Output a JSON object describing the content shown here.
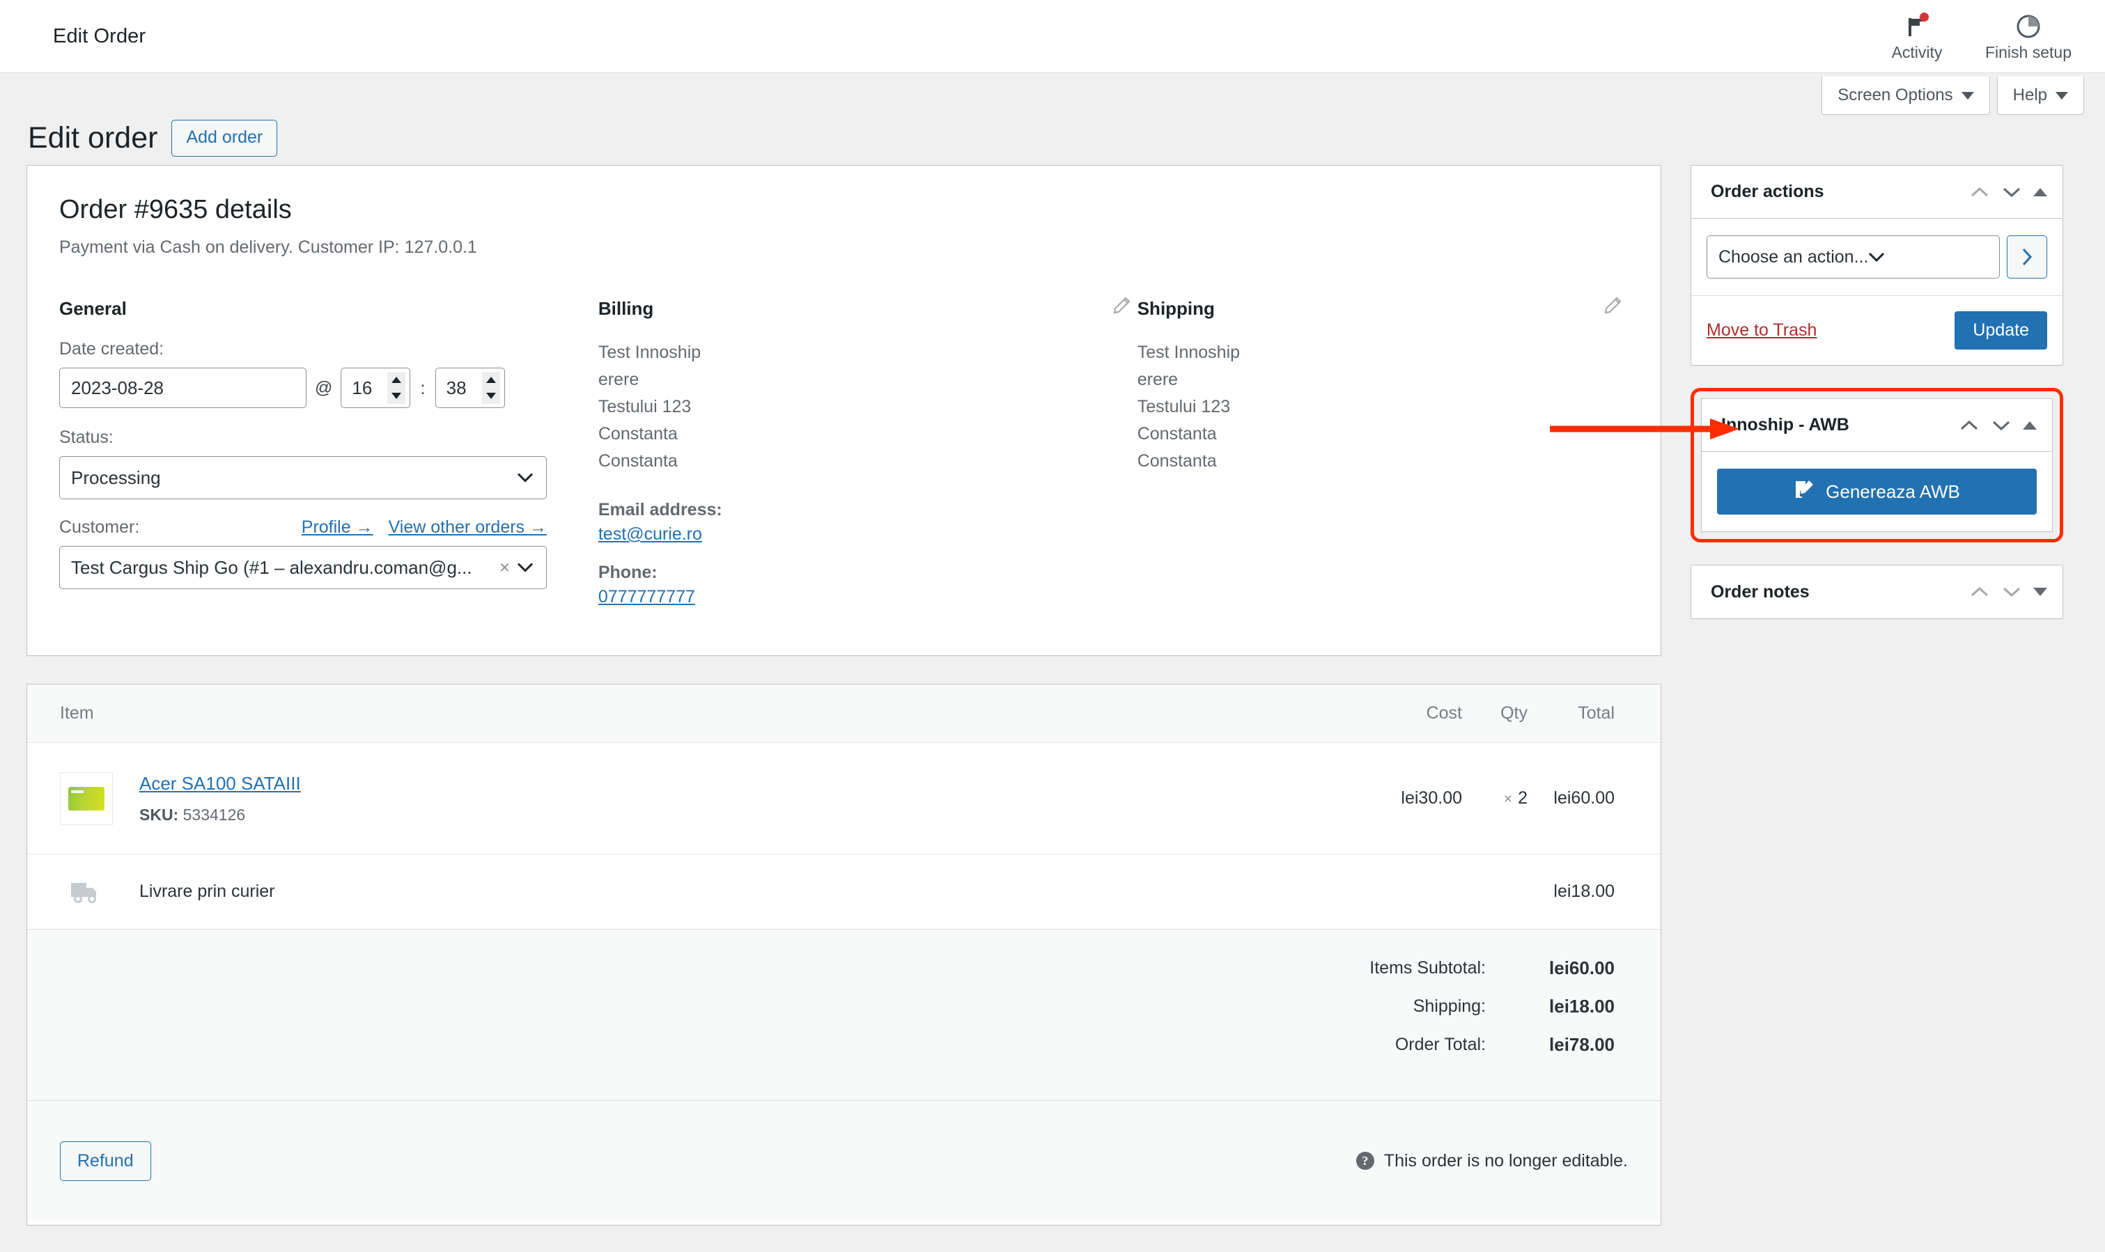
{
  "adminbar": {
    "title": "Edit Order",
    "items": [
      {
        "label": "Activity",
        "icon": "flag-icon"
      },
      {
        "label": "Finish setup",
        "icon": "progress-circle-icon"
      }
    ]
  },
  "screen_meta": {
    "screen_options": "Screen Options",
    "help": "Help"
  },
  "page": {
    "title": "Edit order",
    "add_order_button": "Add order"
  },
  "order": {
    "heading": "Order #9635 details",
    "subheading": "Payment via Cash on delivery. Customer IP: 127.0.0.1",
    "general": {
      "title": "General",
      "date_label": "Date created:",
      "date_value": "2023-08-28",
      "at_symbol": "@",
      "hour_value": "16",
      "colon": ":",
      "minute_value": "38",
      "status_label": "Status:",
      "status_value": "Processing",
      "customer_label": "Customer:",
      "profile_link": "Profile →",
      "view_other_orders_link": "View other orders →",
      "customer_value": "Test Cargus Ship Go (#1 – alexandru.coman@g...",
      "clear_symbol": "×"
    },
    "billing": {
      "title": "Billing",
      "address": [
        "Test Innoship",
        "erere",
        "Testului 123",
        "Constanta",
        "Constanta"
      ],
      "email_label": "Email address:",
      "email_value": "test@curie.ro",
      "phone_label": "Phone:",
      "phone_value": "0777777777"
    },
    "shipping": {
      "title": "Shipping",
      "address": [
        "Test Innoship",
        "erere",
        "Testului 123",
        "Constanta",
        "Constanta"
      ]
    }
  },
  "items": {
    "columns": {
      "item": "Item",
      "cost": "Cost",
      "qty": "Qty",
      "total": "Total"
    },
    "rows": [
      {
        "name": "Acer SA100 SATAIII",
        "sku_label": "SKU:",
        "sku_value": "5334126",
        "cost": "lei30.00",
        "qty_sym": "×",
        "qty": "2",
        "total": "lei60.00"
      }
    ],
    "shipping_row": {
      "name": "Livrare prin curier",
      "total": "lei18.00"
    },
    "totals": [
      {
        "label": "Items Subtotal:",
        "value": "lei60.00"
      },
      {
        "label": "Shipping:",
        "value": "lei18.00"
      },
      {
        "label": "Order Total:",
        "value": "lei78.00"
      }
    ],
    "refund_button": "Refund",
    "not_editable_notice": "This order is no longer editable."
  },
  "sidebar": {
    "order_actions": {
      "title": "Order actions",
      "action_select_value": "Choose an action...",
      "go_symbol": "›",
      "trash_link": "Move to Trash",
      "update_button": "Update"
    },
    "innoship_awb": {
      "title": "Innoship - AWB",
      "generate_button": "Genereaza AWB"
    },
    "order_notes": {
      "title": "Order notes"
    }
  },
  "annotation": {
    "arrow_color": "#ff2d00",
    "highlight_color": "#ff2d00"
  }
}
